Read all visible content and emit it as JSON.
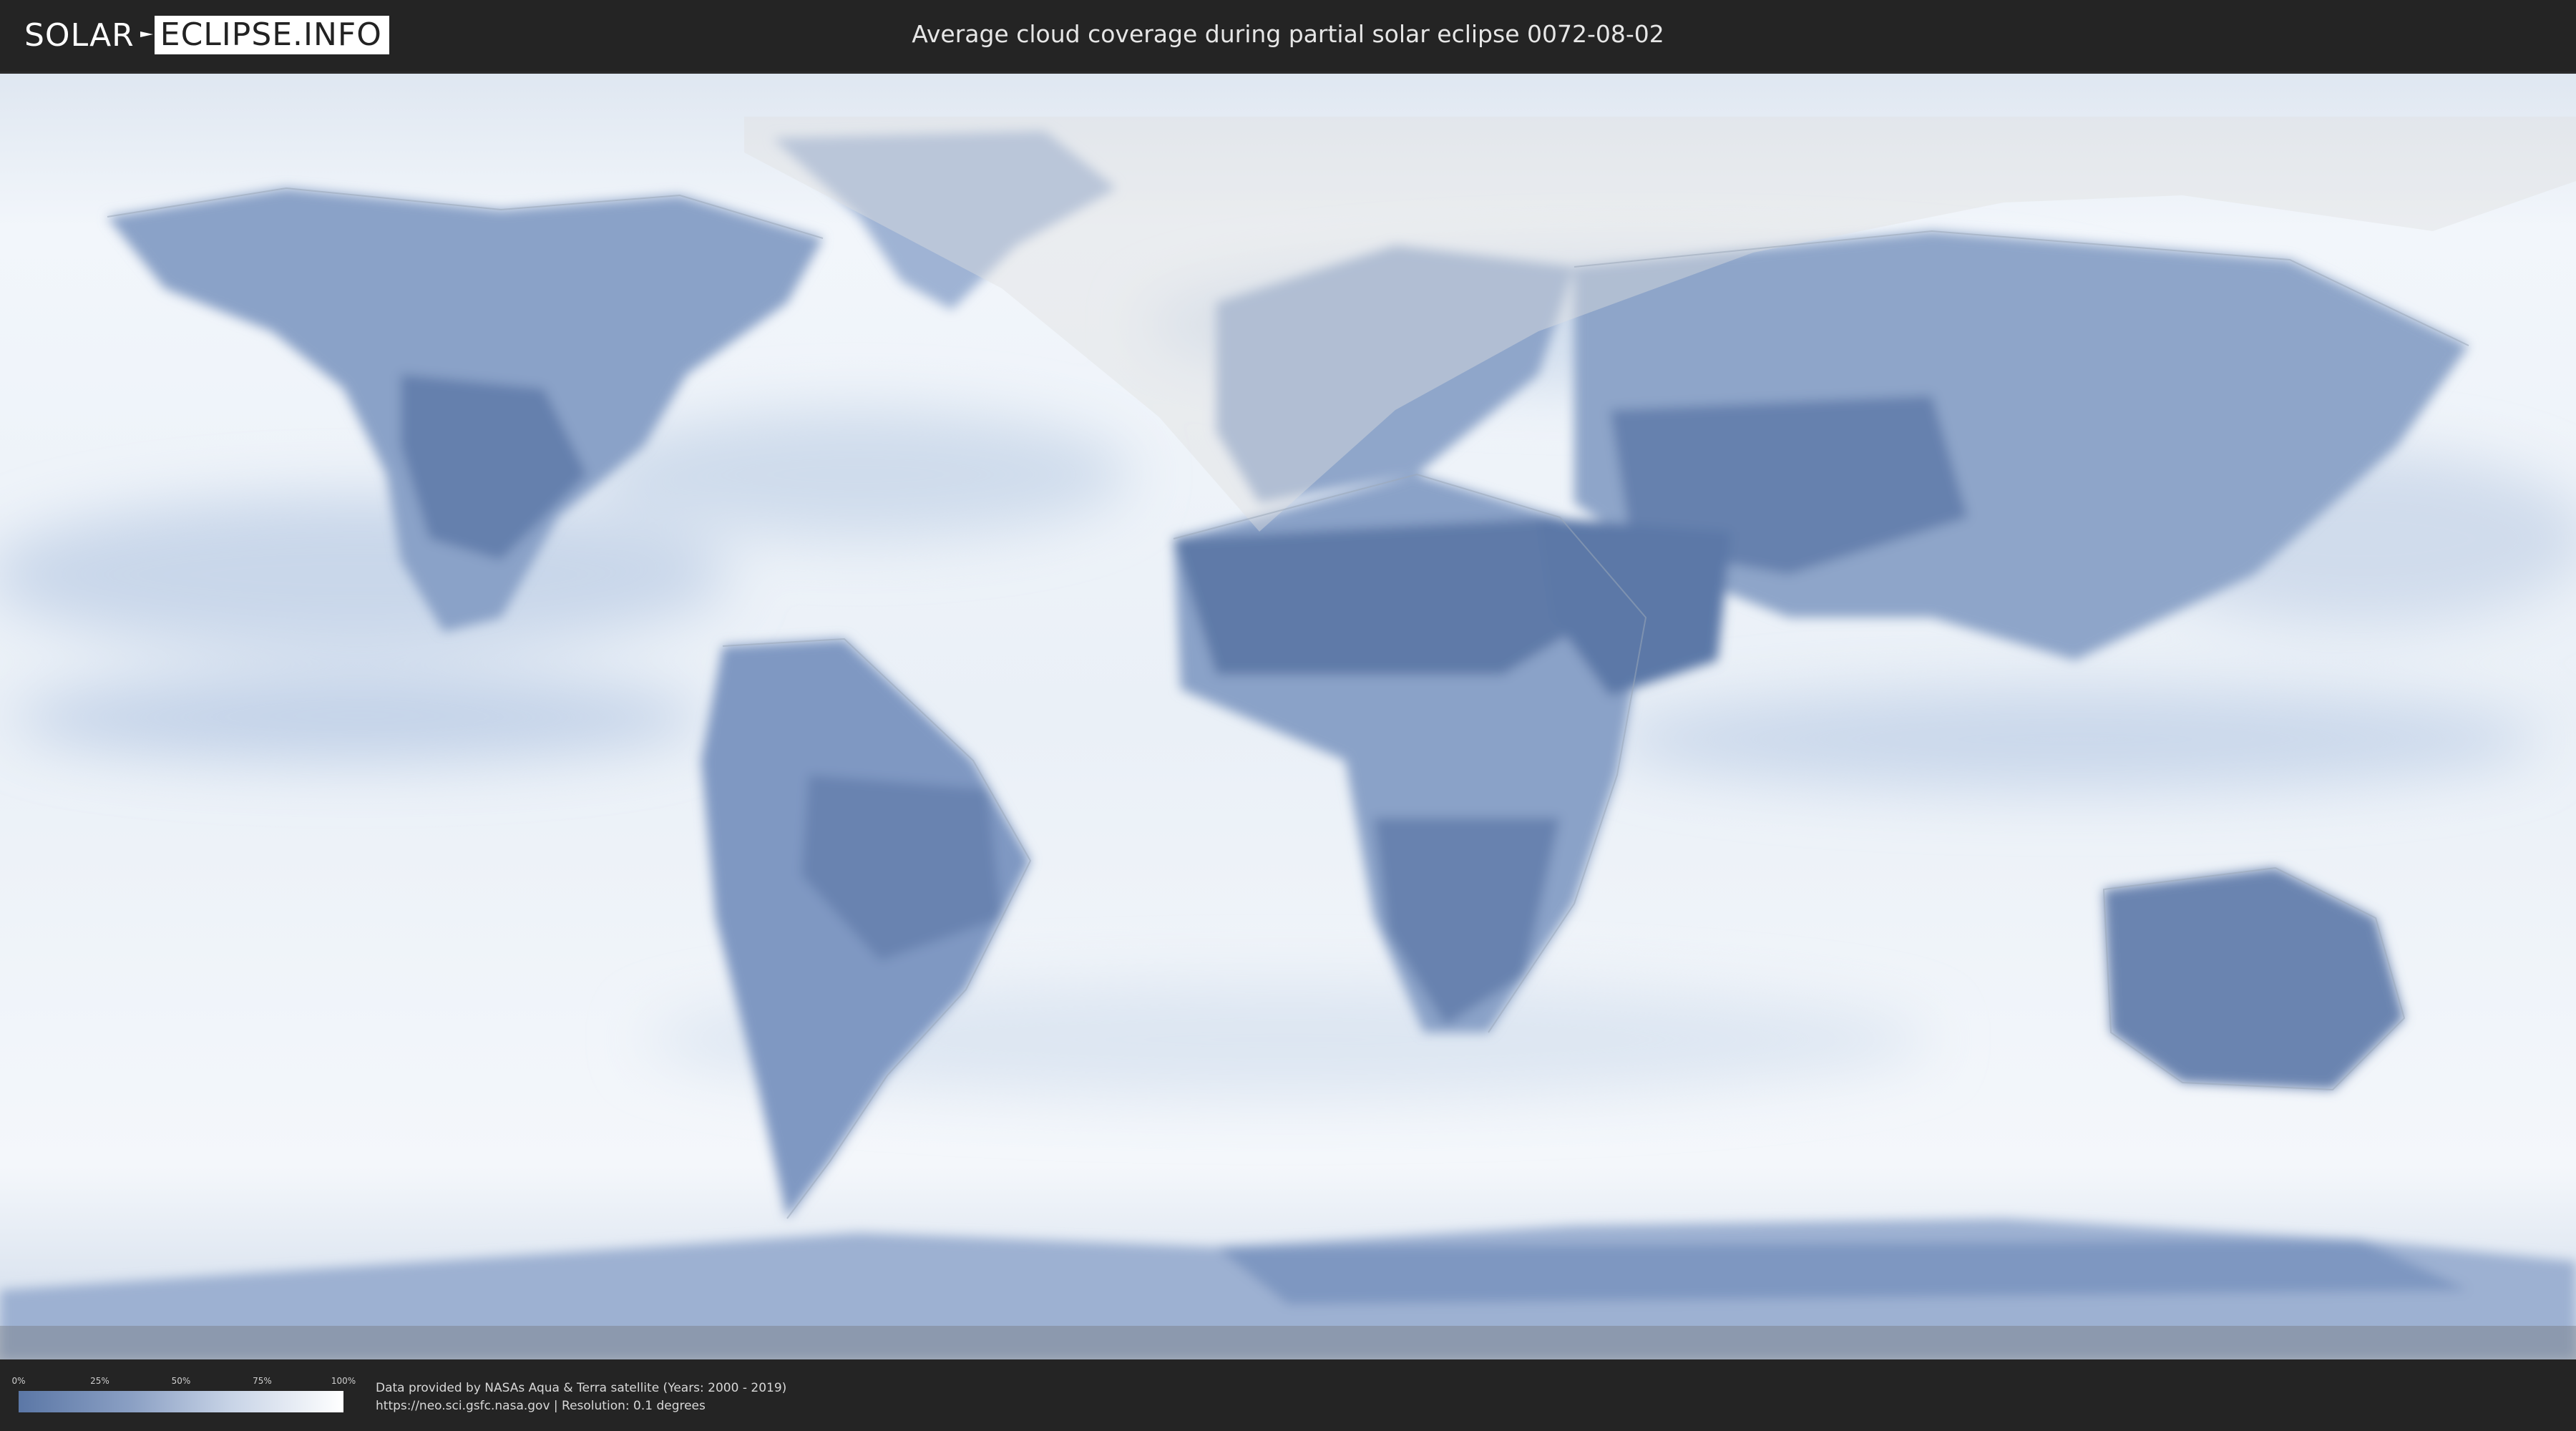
{
  "header": {
    "logo_left": "SOLAR",
    "logo_right": "ECLIPSE.INFO",
    "title": "Average cloud coverage during partial solar eclipse 0072-08-02"
  },
  "legend": {
    "ticks": [
      "0%",
      "25%",
      "50%",
      "75%",
      "100%"
    ],
    "colors": [
      "#5b77a6",
      "#8ba0c4",
      "#c7d3e6",
      "#ffffff"
    ]
  },
  "footer": {
    "source_line": "Data provided by NASAs Aqua & Terra satellite (Years: 2000 - 2019)",
    "url_line": "https://neo.sci.gsfc.nasa.gov | Resolution: 0.1 degrees"
  },
  "map": {
    "layers": [
      "cloud-coverage",
      "eclipse-visibility-zone",
      "country-borders"
    ],
    "accent_land": "#5e7aa8",
    "ocean_light": "#eef3f9"
  }
}
